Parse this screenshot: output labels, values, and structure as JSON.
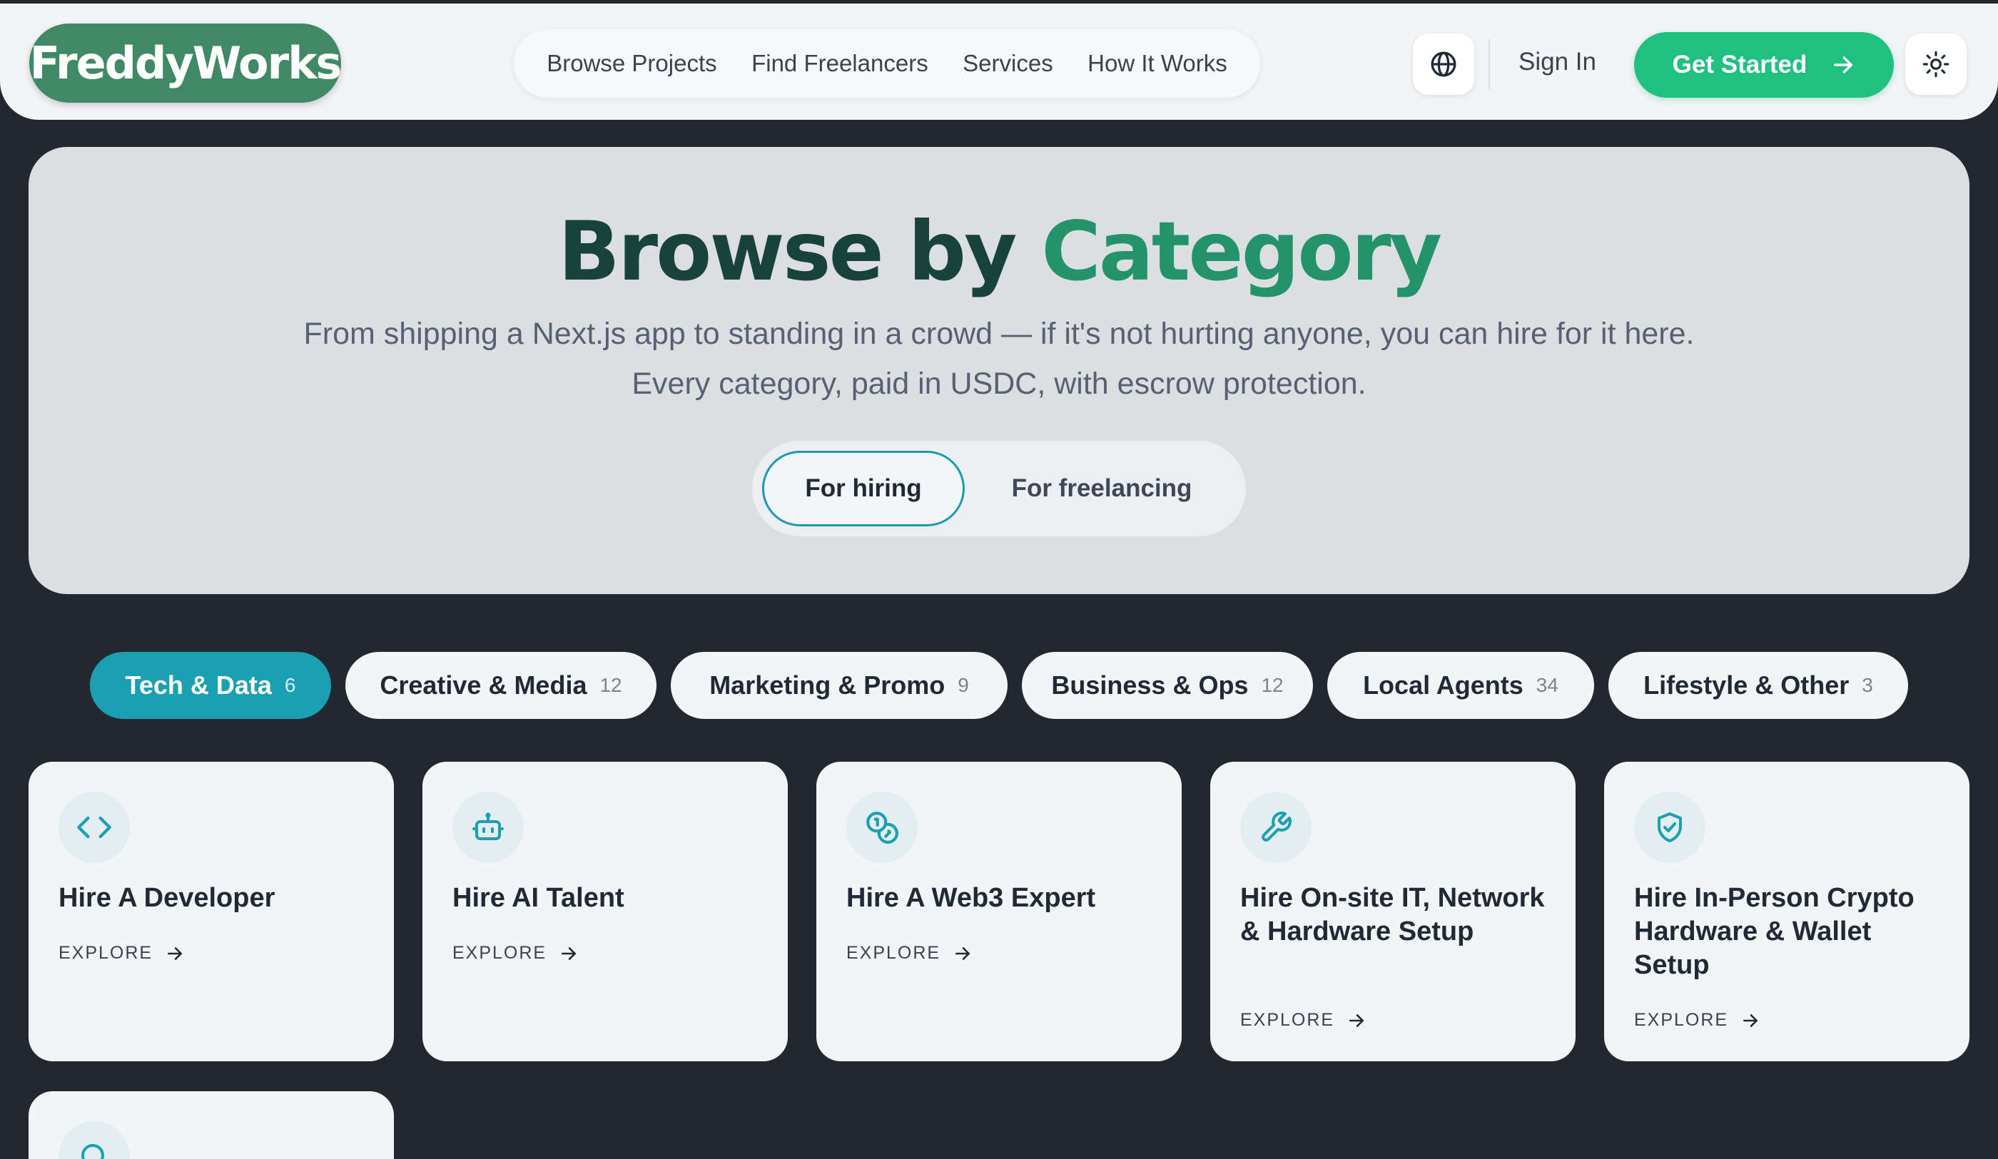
{
  "header": {
    "logo_text": "FreddyWorks",
    "nav": [
      "Browse Projects",
      "Find Freelancers",
      "Services",
      "How It Works"
    ],
    "globe_icon": "globe-icon",
    "sign_in_label": "Sign In",
    "get_started_label": "Get Started",
    "theme_icon": "sun-icon"
  },
  "hero": {
    "title_part1": "Browse by",
    "title_part2": "Category",
    "subtitle_line1": "From shipping a Next.js app to standing in a crowd — if it's not hurting anyone, you can hire for it here.",
    "subtitle_line2": "Every category, paid in USDC, with escrow protection.",
    "toggle": {
      "hiring_label": "For hiring",
      "freelancing_label": "For freelancing",
      "selected": "For hiring"
    }
  },
  "categories": [
    {
      "label": "Tech & Data",
      "count": "6"
    },
    {
      "label": "Creative & Media",
      "count": "12"
    },
    {
      "label": "Marketing & Promo",
      "count": "9"
    },
    {
      "label": "Business & Ops",
      "count": "12"
    },
    {
      "label": "Local Agents",
      "count": "34"
    },
    {
      "label": "Lifestyle & Other",
      "count": "3"
    }
  ],
  "active_category": "Tech & Data",
  "cards": [
    {
      "title": "Hire A Developer",
      "explore": "EXPLORE",
      "icon": "code-icon"
    },
    {
      "title": "Hire AI Talent",
      "explore": "EXPLORE",
      "icon": "robot-icon"
    },
    {
      "title": "Hire A Web3 Expert",
      "explore": "EXPLORE",
      "icon": "coins-icon"
    },
    {
      "title": "Hire On-site IT, Network & Hardware Setup",
      "explore": "EXPLORE",
      "icon": "wrench-icon"
    },
    {
      "title": "Hire In-Person Crypto Hardware & Wallet Setup",
      "explore": "EXPLORE",
      "icon": "shield-check-icon"
    }
  ],
  "colors": {
    "page_bg": "#222830",
    "brand_green": "#3f8a64",
    "cta_green": "#1fc080",
    "accent_teal": "#1b9fb3",
    "title_dark": "#17433a",
    "title_green": "#22936a"
  }
}
